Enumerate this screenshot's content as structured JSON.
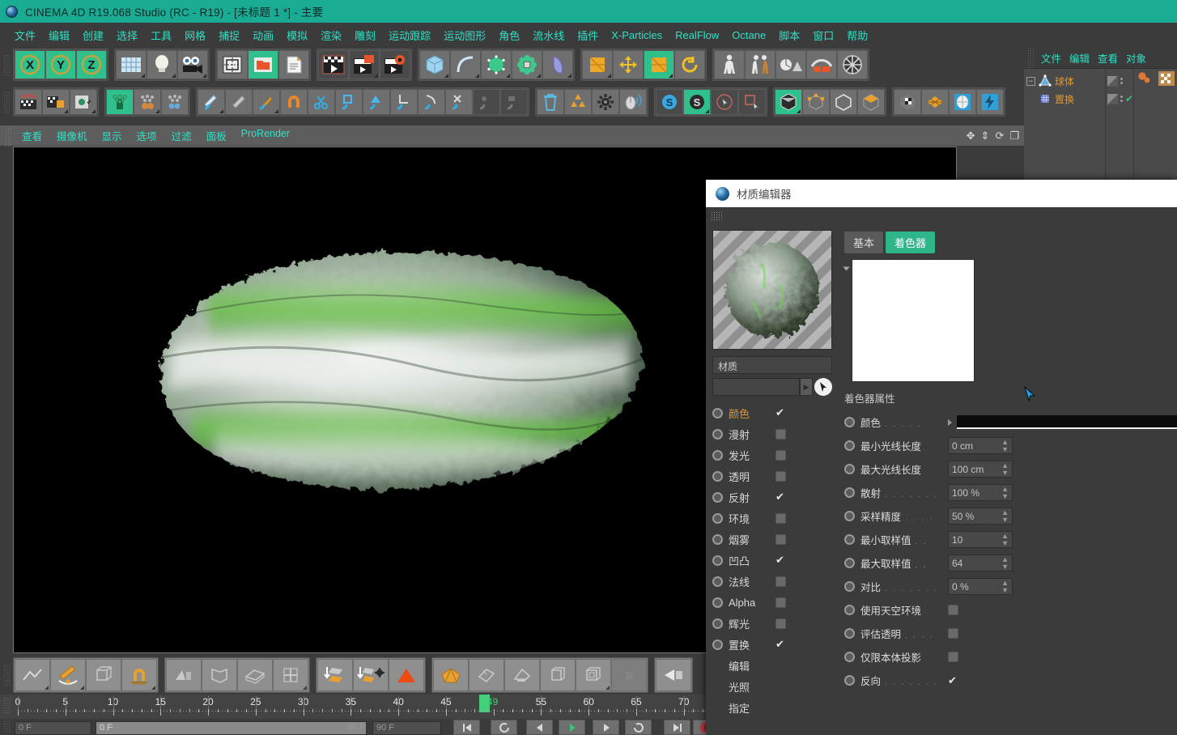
{
  "window": {
    "title": "CINEMA 4D R19.068 Studio (RC - R19) - [未标题 1 *] - 主要",
    "logo_icon": "c4d-logo-icon",
    "title_bg": "#1aab94"
  },
  "menubar": {
    "items": [
      {
        "label": "文件"
      },
      {
        "label": "编辑"
      },
      {
        "label": "创建"
      },
      {
        "label": "选择"
      },
      {
        "label": "工具"
      },
      {
        "label": "网格"
      },
      {
        "label": "捕捉"
      },
      {
        "label": "动画"
      },
      {
        "label": "模拟"
      },
      {
        "label": "渲染"
      },
      {
        "label": "雕刻"
      },
      {
        "label": "运动跟踪"
      },
      {
        "label": "运动图形"
      },
      {
        "label": "角色"
      },
      {
        "label": "流水线"
      },
      {
        "label": "插件"
      },
      {
        "label": "X-Particles"
      },
      {
        "label": "RealFlow"
      },
      {
        "label": "Octane"
      },
      {
        "label": "脚本"
      },
      {
        "label": "窗口"
      },
      {
        "label": "帮助"
      }
    ],
    "accent": "#2fe0c6"
  },
  "viewport": {
    "menu": [
      {
        "label": "查看"
      },
      {
        "label": "摄像机"
      },
      {
        "label": "显示"
      },
      {
        "label": "选项"
      },
      {
        "label": "过滤"
      },
      {
        "label": "面板"
      },
      {
        "label": "ProRender"
      }
    ],
    "nav_icons": [
      "pan-icon",
      "zoom-icon",
      "rotate-icon",
      "maximize-icon"
    ],
    "background": "#000000",
    "object_description": "displaced sphere mesh, green and white"
  },
  "object_manager": {
    "menu": [
      {
        "label": "文件"
      },
      {
        "label": "编辑"
      },
      {
        "label": "查看"
      },
      {
        "label": "对象"
      }
    ],
    "rows": [
      {
        "label": "球体",
        "icon": "sphere-icon",
        "expanded": true,
        "indent": 0
      },
      {
        "label": "置换",
        "icon": "displacer-icon",
        "expanded": false,
        "indent": 1
      }
    ]
  },
  "timeline": {
    "min": 0,
    "max": 73,
    "labels": [
      "0",
      "5",
      "10",
      "15",
      "20",
      "25",
      "30",
      "35",
      "40",
      "45",
      "55",
      "60",
      "65",
      "70"
    ],
    "label_values": [
      0,
      5,
      10,
      15,
      20,
      25,
      30,
      35,
      40,
      45,
      55,
      60,
      65,
      70
    ],
    "current_frame": "49",
    "current_frame_value": 49,
    "playhead_color": "#44d07a"
  },
  "bottom_fields": {
    "field1": "0 F",
    "field2": "0 F",
    "field3": "90 F",
    "field4": "90 F"
  },
  "material_editor": {
    "title": "材质编辑器",
    "logo_icon": "c4d-logo-icon",
    "material_name": "材质",
    "picker_value": "",
    "preview_icon": "material-preview-sphere",
    "channels": [
      {
        "label": "颜色",
        "checked": true,
        "active": true
      },
      {
        "label": "漫射",
        "checked": false,
        "active": false
      },
      {
        "label": "发光",
        "checked": false,
        "active": false
      },
      {
        "label": "透明",
        "checked": false,
        "active": false
      },
      {
        "label": "反射",
        "checked": true,
        "active": false
      },
      {
        "label": "环境",
        "checked": false,
        "active": false
      },
      {
        "label": "烟雾",
        "checked": false,
        "active": false
      },
      {
        "label": "凹凸",
        "checked": true,
        "active": false
      },
      {
        "label": "法线",
        "checked": false,
        "active": false
      },
      {
        "label": "Alpha",
        "checked": false,
        "active": false
      },
      {
        "label": "辉光",
        "checked": false,
        "active": false
      },
      {
        "label": "置换",
        "checked": true,
        "active": false
      }
    ],
    "extra_items": [
      {
        "label": "编辑"
      },
      {
        "label": "光照"
      },
      {
        "label": "指定"
      }
    ],
    "tabs": [
      {
        "label": "基本",
        "active": false
      },
      {
        "label": "着色器",
        "active": true
      }
    ],
    "tab_active_color": "#2fb58a",
    "shader_preview_color": "#ffffff",
    "section_title": "着色器属性",
    "properties": [
      {
        "label": "颜色",
        "dots": ". . . . .",
        "type": "color",
        "value": "#0b0b0b"
      },
      {
        "label": "最小光线长度",
        "dots": "",
        "type": "number",
        "value": "0 cm"
      },
      {
        "label": "最大光线长度",
        "dots": "",
        "type": "number",
        "value": "100 cm"
      },
      {
        "label": "散射",
        "dots": ". . . . . . .",
        "type": "number",
        "value": "100 %"
      },
      {
        "label": "采样精度",
        "dots": ". . . .",
        "type": "number",
        "value": "50 %"
      },
      {
        "label": "最小取样值",
        "dots": ". .",
        "type": "number",
        "value": "10"
      },
      {
        "label": "最大取样值",
        "dots": ". .",
        "type": "number",
        "value": "64"
      },
      {
        "label": "对比",
        "dots": ". . . . . . .",
        "type": "number",
        "value": "0 %"
      },
      {
        "label": "使用天空环境",
        "dots": "",
        "type": "checkbox",
        "checked": false
      },
      {
        "label": "评估透明",
        "dots": ". . . .",
        "type": "checkbox",
        "checked": false
      },
      {
        "label": "仅限本体投影",
        "dots": "",
        "type": "checkbox",
        "checked": false
      },
      {
        "label": "反向",
        "dots": ". . . . . . .",
        "type": "checkbox",
        "checked": true
      }
    ]
  }
}
